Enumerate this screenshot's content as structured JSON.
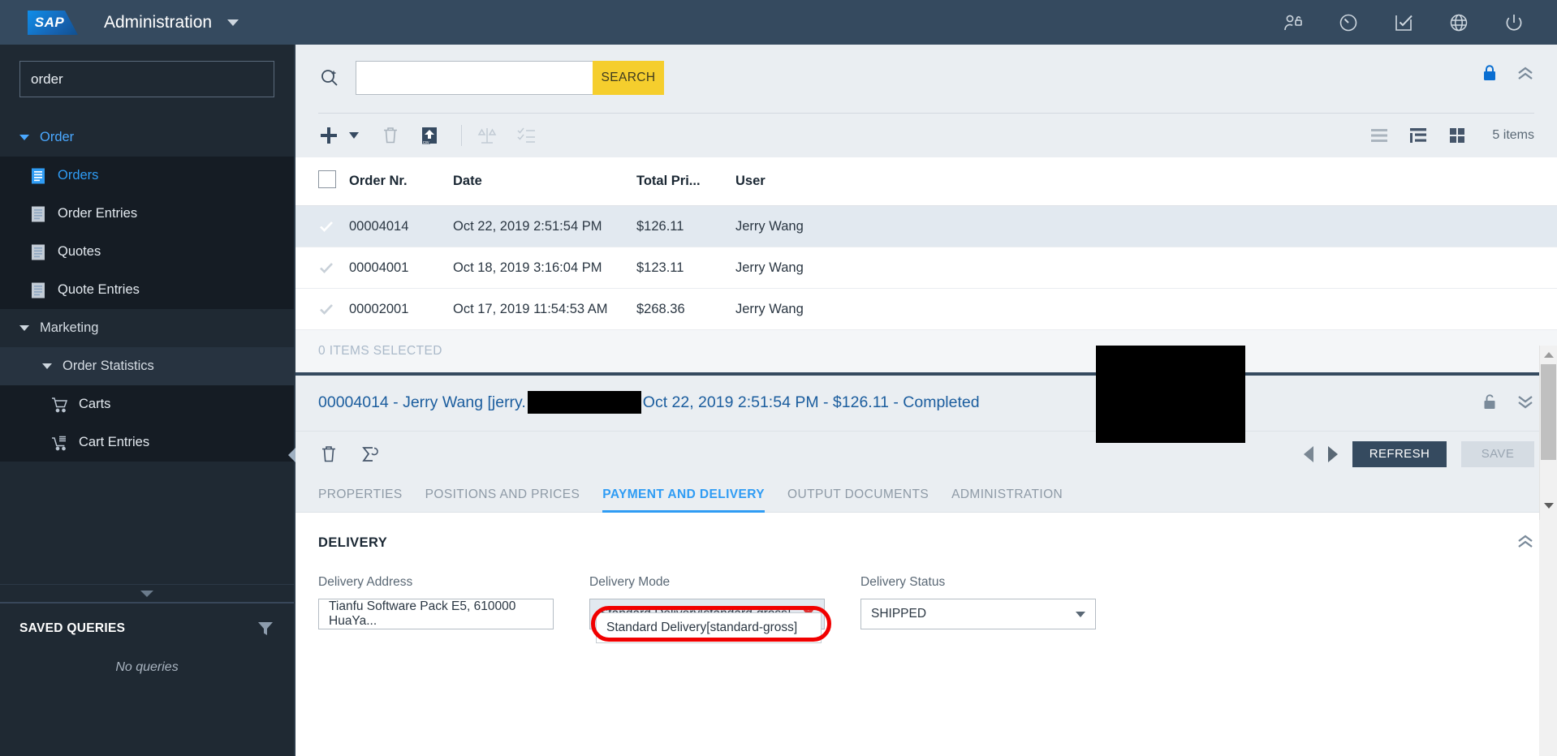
{
  "header": {
    "logo_text": "SAP",
    "app_title": "Administration",
    "icons": [
      {
        "name": "user-unlock-icon"
      },
      {
        "name": "history-undo-icon"
      },
      {
        "name": "checklist-icon"
      },
      {
        "name": "globe-icon"
      },
      {
        "name": "power-icon"
      }
    ]
  },
  "sidebar": {
    "search_value": "order",
    "search_placeholder": "",
    "groups": [
      {
        "label": "Order",
        "level": 0,
        "accent": true
      },
      {
        "label": "Marketing",
        "level": 0,
        "accent": false
      },
      {
        "label": "Order Statistics",
        "level": 1,
        "accent": false
      }
    ],
    "order_items": [
      {
        "label": "Orders",
        "icon": "document-blue-icon",
        "active": true
      },
      {
        "label": "Order Entries",
        "icon": "document-icon",
        "active": false
      },
      {
        "label": "Quotes",
        "icon": "document-icon",
        "active": false
      },
      {
        "label": "Quote Entries",
        "icon": "document-icon",
        "active": false
      }
    ],
    "stats_items": [
      {
        "label": "Carts",
        "icon": "cart-icon"
      },
      {
        "label": "Cart Entries",
        "icon": "cart-lines-icon"
      }
    ],
    "saved_queries": {
      "title": "SAVED QUERIES",
      "empty_text": "No queries",
      "filter_icon": "funnel-icon"
    }
  },
  "search": {
    "value": "",
    "placeholder": "",
    "button_label": "SEARCH",
    "icon": "search-add-icon",
    "lock_icon": "lock-icon",
    "collapse_icon": "chevron-double-up-icon"
  },
  "toolbar": {
    "icons": [
      {
        "name": "add-icon"
      },
      {
        "name": "add-dropdown-caret"
      },
      {
        "name": "delete-icon"
      },
      {
        "name": "export-csv-icon"
      },
      {
        "name": "compare-icon"
      },
      {
        "name": "checklist-select-icon"
      }
    ],
    "view_modes": [
      {
        "name": "list-view-icon"
      },
      {
        "name": "tree-view-icon"
      },
      {
        "name": "grid-view-icon"
      }
    ],
    "items_count": "5 items"
  },
  "table": {
    "columns": [
      "Order Nr.",
      "Date",
      "Total Pri...",
      "User"
    ],
    "rows": [
      {
        "nr": "00004014",
        "date": "Oct 22, 2019 2:51:54 PM",
        "price": "$126.11",
        "user": "Jerry Wang",
        "selected": true
      },
      {
        "nr": "00004001",
        "date": "Oct 18, 2019 3:16:04 PM",
        "price": "$123.11",
        "user": "Jerry Wang",
        "selected": false
      },
      {
        "nr": "00002001",
        "date": "Oct 17, 2019 11:54:53 AM",
        "price": "$268.36",
        "user": "Jerry Wang",
        "selected": false
      }
    ],
    "selection_status": "0 ITEMS SELECTED"
  },
  "detail": {
    "title_prefix": "00004014 - Jerry Wang [jerry.",
    "title_suffix": "Oct 22, 2019 2:51:54 PM - $126.11 - Completed",
    "lock_icon": "unlock-icon",
    "collapse_icon": "chevron-double-down-icon",
    "toolbar_icons": [
      {
        "name": "delete-icon"
      },
      {
        "name": "recalculate-sigma-icon"
      }
    ],
    "prev_label": "previous",
    "next_label": "next",
    "refresh_label": "REFRESH",
    "save_label": "SAVE",
    "tabs": [
      {
        "label": "PROPERTIES",
        "active": false
      },
      {
        "label": "POSITIONS AND PRICES",
        "active": false
      },
      {
        "label": "PAYMENT AND DELIVERY",
        "active": true
      },
      {
        "label": "OUTPUT DOCUMENTS",
        "active": false
      },
      {
        "label": "ADMINISTRATION",
        "active": false
      }
    ],
    "section": {
      "title": "DELIVERY",
      "collapse_icon": "chevron-double-up-icon",
      "fields": [
        {
          "label": "Delivery Address",
          "value": "Tianfu Software Pack E5, 610000 HuaYa...",
          "type": "text"
        },
        {
          "label": "Delivery Mode",
          "value": "Standard Delivery[standard-gross]",
          "type": "token",
          "clear": "✖"
        },
        {
          "label": "Delivery Status",
          "value": "SHIPPED",
          "type": "select"
        }
      ],
      "suggestion": "Standard Delivery[standard-gross]"
    }
  },
  "colors": {
    "header_bg": "#354a5f",
    "sidebar_bg": "#1f2933",
    "accent_blue": "#2f9cf4",
    "search_yellow": "#f5ce2d",
    "highlight_red": "#f10000",
    "selected_row": "#e2e9f0"
  }
}
